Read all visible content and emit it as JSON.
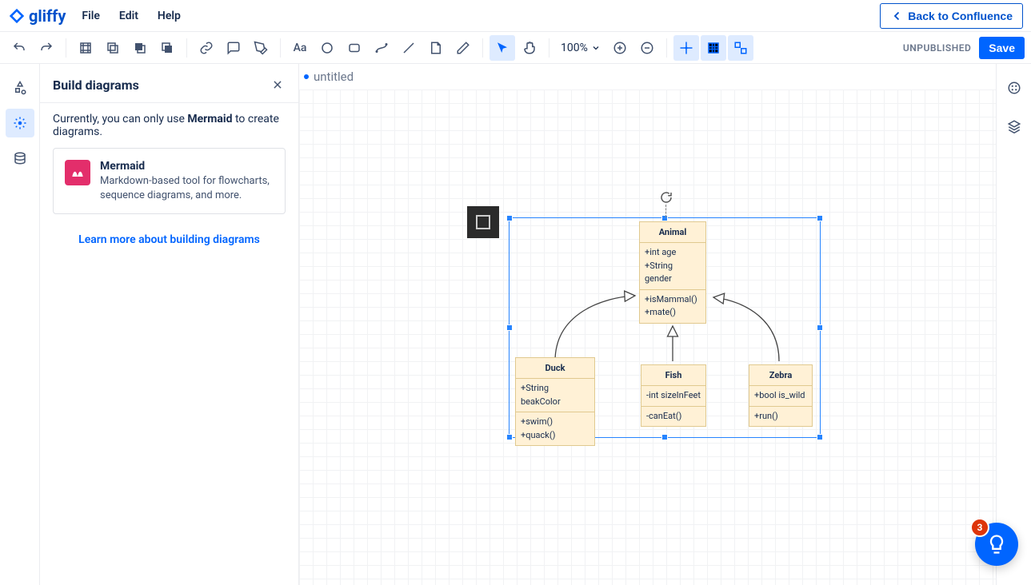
{
  "menubar": {
    "logo_text": "gliffy",
    "items": [
      "File",
      "Edit",
      "Help"
    ],
    "back_label": "Back to Confluence"
  },
  "toolbar": {
    "zoom": "100%",
    "status": "UNPUBLISHED",
    "save": "Save"
  },
  "panel": {
    "title": "Build diagrams",
    "hint_pre": "Currently, you can only use ",
    "hint_bold": "Mermaid",
    "hint_post": " to create diagrams.",
    "card_title": "Mermaid",
    "card_desc": "Markdown-based tool for flowcharts, sequence diagrams, and more.",
    "learn": "Learn more about building diagrams"
  },
  "tab": {
    "title": "untitled"
  },
  "help": {
    "badge": "3"
  },
  "diagram": {
    "animal": {
      "name": "Animal",
      "attrs": [
        "+int age",
        "+String gender"
      ],
      "methods": [
        "+isMammal()",
        "+mate()"
      ]
    },
    "duck": {
      "name": "Duck",
      "attrs": [
        "+String beakColor"
      ],
      "methods": [
        "+swim()",
        "+quack()"
      ]
    },
    "fish": {
      "name": "Fish",
      "attrs": [
        "-int sizeInFeet"
      ],
      "methods": [
        "-canEat()"
      ]
    },
    "zebra": {
      "name": "Zebra",
      "attrs": [
        "+bool is_wild"
      ],
      "methods": [
        "+run()"
      ]
    }
  }
}
